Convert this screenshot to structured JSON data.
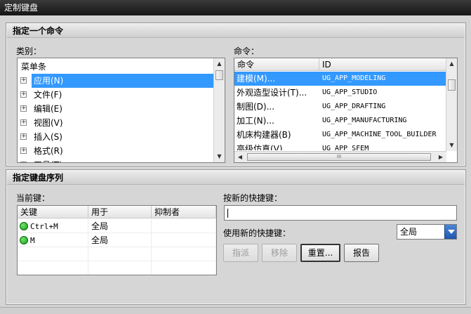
{
  "window": {
    "title": "定制键盘"
  },
  "section1": {
    "title": "指定一个命令",
    "category_label": "类别：",
    "command_label": "命令：",
    "categories": [
      {
        "label": "菜单条",
        "expander": false,
        "selected": false
      },
      {
        "label": "应用(N)",
        "expander": true,
        "selected": true
      },
      {
        "label": "文件(F)",
        "expander": true,
        "selected": false
      },
      {
        "label": "编辑(E)",
        "expander": true,
        "selected": false
      },
      {
        "label": "视图(V)",
        "expander": true,
        "selected": false
      },
      {
        "label": "插入(S)",
        "expander": true,
        "selected": false
      },
      {
        "label": "格式(R)",
        "expander": true,
        "selected": false
      },
      {
        "label": "工具(T)",
        "expander": true,
        "selected": false
      }
    ],
    "command_columns": [
      "命令",
      "ID"
    ],
    "commands": [
      {
        "name": "建模(M)...",
        "id": "UG_APP_MODELING",
        "selected": true
      },
      {
        "name": "外观造型设计(T)...",
        "id": "UG_APP_STUDIO",
        "selected": false
      },
      {
        "name": "制图(D)...",
        "id": "UG_APP_DRAFTING",
        "selected": false
      },
      {
        "name": "加工(N)...",
        "id": "UG_APP_MANUFACTURING",
        "selected": false
      },
      {
        "name": "机床构建器(B)",
        "id": "UG_APP_MACHINE_TOOL_BUILDER",
        "selected": false
      },
      {
        "name": "高级仿真(V)",
        "id": "UG_APP_SFEM",
        "selected": false
      }
    ],
    "hscroll_grip": "III"
  },
  "section2": {
    "title": "指定键盘序列",
    "current_keys_label": "当前键：",
    "key_columns": [
      "关键",
      "用于",
      "抑制者"
    ],
    "keys": [
      {
        "key": "Ctrl+M",
        "scope": "全局",
        "suppressed_by": ""
      },
      {
        "key": "M",
        "scope": "全局",
        "suppressed_by": ""
      }
    ],
    "new_shortcut_label": "按新的快捷键：",
    "new_shortcut_value": "",
    "use_new_label": "使用新的快捷键：",
    "scope_selected": "全局",
    "buttons": {
      "assign": "指派",
      "remove": "移除",
      "reset": "重置...",
      "report": "报告"
    }
  },
  "colors": {
    "selection": "#3399ff",
    "status_dot": "#1fb51f",
    "combo_button": "#2a64c0"
  }
}
